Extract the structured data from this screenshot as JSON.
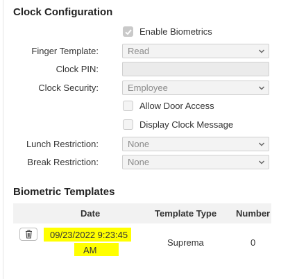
{
  "clock_config": {
    "title": "Clock Configuration",
    "enable_biometrics": {
      "label": "Enable Biometrics",
      "checked": true
    },
    "finger_template": {
      "label": "Finger Template:",
      "value": "Read"
    },
    "clock_pin": {
      "label": "Clock PIN:",
      "value": ""
    },
    "clock_security": {
      "label": "Clock Security:",
      "value": "Employee"
    },
    "allow_door_access": {
      "label": "Allow Door Access",
      "checked": false
    },
    "display_clock_message": {
      "label": "Display Clock Message",
      "checked": false
    },
    "lunch_restriction": {
      "label": "Lunch Restriction:",
      "value": "None"
    },
    "break_restriction": {
      "label": "Break Restriction:",
      "value": "None"
    }
  },
  "biometric_templates": {
    "title": "Biometric Templates",
    "columns": [
      "Date",
      "Template Type",
      "Number"
    ],
    "rows": [
      {
        "date_line1": "09/23/2022 9:23:45",
        "date_line2": "AM",
        "template_type": "Suprema",
        "number": "0"
      }
    ]
  },
  "colors": {
    "highlight": "#ffff00",
    "disabled_bg": "#f3f3f3",
    "header_bg": "#f2f2f2"
  }
}
